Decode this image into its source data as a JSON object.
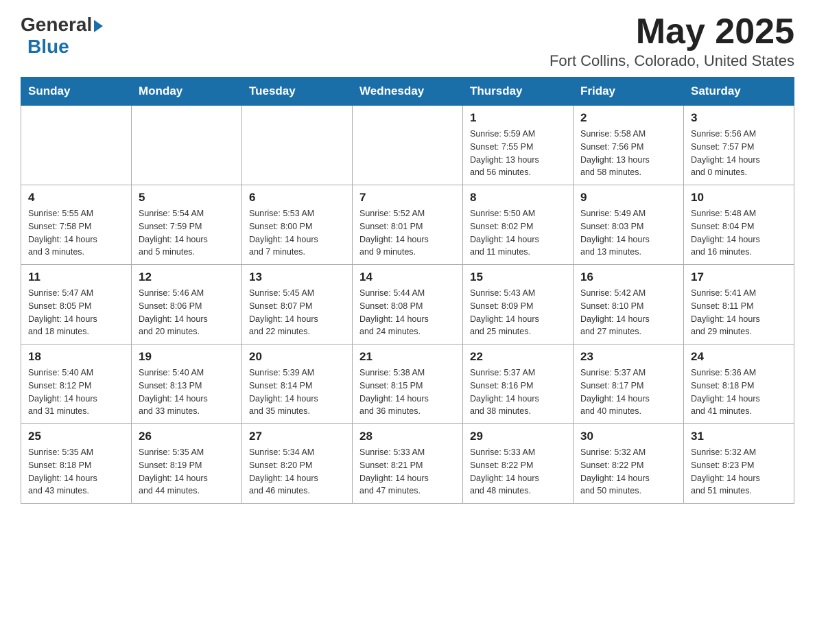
{
  "header": {
    "logo_general": "General",
    "logo_blue": "Blue",
    "month_title": "May 2025",
    "location": "Fort Collins, Colorado, United States"
  },
  "days_of_week": [
    "Sunday",
    "Monday",
    "Tuesday",
    "Wednesday",
    "Thursday",
    "Friday",
    "Saturday"
  ],
  "weeks": [
    [
      {
        "day": "",
        "info": ""
      },
      {
        "day": "",
        "info": ""
      },
      {
        "day": "",
        "info": ""
      },
      {
        "day": "",
        "info": ""
      },
      {
        "day": "1",
        "info": "Sunrise: 5:59 AM\nSunset: 7:55 PM\nDaylight: 13 hours\nand 56 minutes."
      },
      {
        "day": "2",
        "info": "Sunrise: 5:58 AM\nSunset: 7:56 PM\nDaylight: 13 hours\nand 58 minutes."
      },
      {
        "day": "3",
        "info": "Sunrise: 5:56 AM\nSunset: 7:57 PM\nDaylight: 14 hours\nand 0 minutes."
      }
    ],
    [
      {
        "day": "4",
        "info": "Sunrise: 5:55 AM\nSunset: 7:58 PM\nDaylight: 14 hours\nand 3 minutes."
      },
      {
        "day": "5",
        "info": "Sunrise: 5:54 AM\nSunset: 7:59 PM\nDaylight: 14 hours\nand 5 minutes."
      },
      {
        "day": "6",
        "info": "Sunrise: 5:53 AM\nSunset: 8:00 PM\nDaylight: 14 hours\nand 7 minutes."
      },
      {
        "day": "7",
        "info": "Sunrise: 5:52 AM\nSunset: 8:01 PM\nDaylight: 14 hours\nand 9 minutes."
      },
      {
        "day": "8",
        "info": "Sunrise: 5:50 AM\nSunset: 8:02 PM\nDaylight: 14 hours\nand 11 minutes."
      },
      {
        "day": "9",
        "info": "Sunrise: 5:49 AM\nSunset: 8:03 PM\nDaylight: 14 hours\nand 13 minutes."
      },
      {
        "day": "10",
        "info": "Sunrise: 5:48 AM\nSunset: 8:04 PM\nDaylight: 14 hours\nand 16 minutes."
      }
    ],
    [
      {
        "day": "11",
        "info": "Sunrise: 5:47 AM\nSunset: 8:05 PM\nDaylight: 14 hours\nand 18 minutes."
      },
      {
        "day": "12",
        "info": "Sunrise: 5:46 AM\nSunset: 8:06 PM\nDaylight: 14 hours\nand 20 minutes."
      },
      {
        "day": "13",
        "info": "Sunrise: 5:45 AM\nSunset: 8:07 PM\nDaylight: 14 hours\nand 22 minutes."
      },
      {
        "day": "14",
        "info": "Sunrise: 5:44 AM\nSunset: 8:08 PM\nDaylight: 14 hours\nand 24 minutes."
      },
      {
        "day": "15",
        "info": "Sunrise: 5:43 AM\nSunset: 8:09 PM\nDaylight: 14 hours\nand 25 minutes."
      },
      {
        "day": "16",
        "info": "Sunrise: 5:42 AM\nSunset: 8:10 PM\nDaylight: 14 hours\nand 27 minutes."
      },
      {
        "day": "17",
        "info": "Sunrise: 5:41 AM\nSunset: 8:11 PM\nDaylight: 14 hours\nand 29 minutes."
      }
    ],
    [
      {
        "day": "18",
        "info": "Sunrise: 5:40 AM\nSunset: 8:12 PM\nDaylight: 14 hours\nand 31 minutes."
      },
      {
        "day": "19",
        "info": "Sunrise: 5:40 AM\nSunset: 8:13 PM\nDaylight: 14 hours\nand 33 minutes."
      },
      {
        "day": "20",
        "info": "Sunrise: 5:39 AM\nSunset: 8:14 PM\nDaylight: 14 hours\nand 35 minutes."
      },
      {
        "day": "21",
        "info": "Sunrise: 5:38 AM\nSunset: 8:15 PM\nDaylight: 14 hours\nand 36 minutes."
      },
      {
        "day": "22",
        "info": "Sunrise: 5:37 AM\nSunset: 8:16 PM\nDaylight: 14 hours\nand 38 minutes."
      },
      {
        "day": "23",
        "info": "Sunrise: 5:37 AM\nSunset: 8:17 PM\nDaylight: 14 hours\nand 40 minutes."
      },
      {
        "day": "24",
        "info": "Sunrise: 5:36 AM\nSunset: 8:18 PM\nDaylight: 14 hours\nand 41 minutes."
      }
    ],
    [
      {
        "day": "25",
        "info": "Sunrise: 5:35 AM\nSunset: 8:18 PM\nDaylight: 14 hours\nand 43 minutes."
      },
      {
        "day": "26",
        "info": "Sunrise: 5:35 AM\nSunset: 8:19 PM\nDaylight: 14 hours\nand 44 minutes."
      },
      {
        "day": "27",
        "info": "Sunrise: 5:34 AM\nSunset: 8:20 PM\nDaylight: 14 hours\nand 46 minutes."
      },
      {
        "day": "28",
        "info": "Sunrise: 5:33 AM\nSunset: 8:21 PM\nDaylight: 14 hours\nand 47 minutes."
      },
      {
        "day": "29",
        "info": "Sunrise: 5:33 AM\nSunset: 8:22 PM\nDaylight: 14 hours\nand 48 minutes."
      },
      {
        "day": "30",
        "info": "Sunrise: 5:32 AM\nSunset: 8:22 PM\nDaylight: 14 hours\nand 50 minutes."
      },
      {
        "day": "31",
        "info": "Sunrise: 5:32 AM\nSunset: 8:23 PM\nDaylight: 14 hours\nand 51 minutes."
      }
    ]
  ]
}
